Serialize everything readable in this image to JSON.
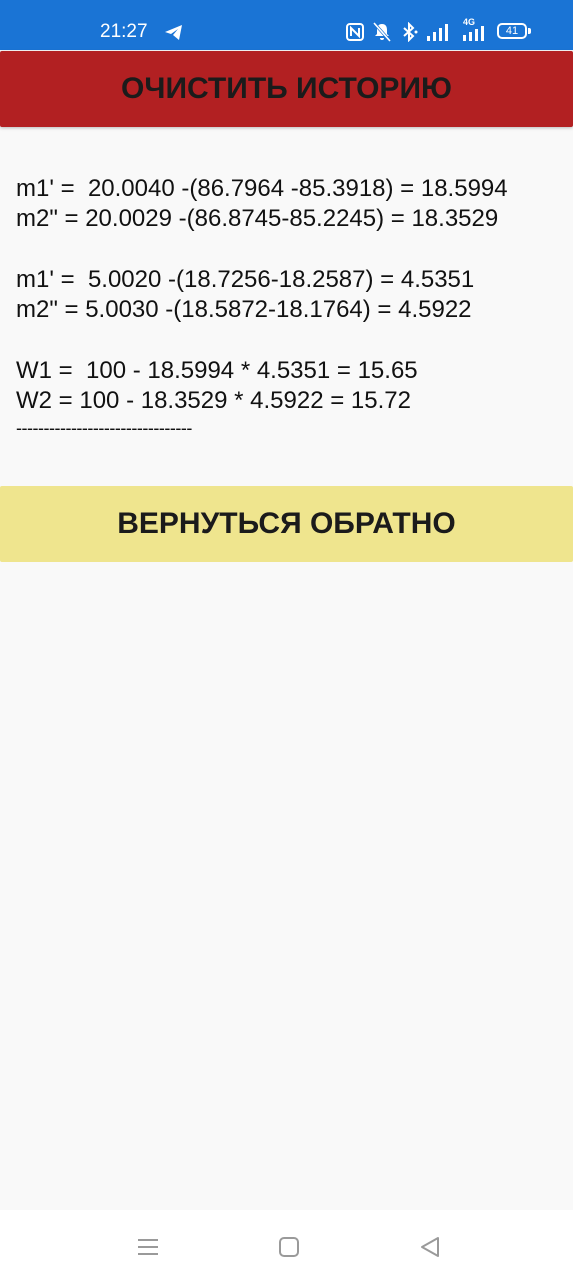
{
  "status_bar": {
    "time": "21:27",
    "network_label": "4G",
    "battery_level": "41",
    "icons": [
      "telegram-icon",
      "nfc-icon",
      "mute-icon",
      "bluetooth-icon",
      "signal-icon",
      "signal-4g-icon",
      "battery-icon"
    ]
  },
  "buttons": {
    "clear_history": "ОЧИСТИТЬ ИСТОРИЮ",
    "go_back": "ВЕРНУТЬСЯ ОБРАТНО"
  },
  "history": {
    "m1_first": "m1' =  20.0040 -(86.7964 -85.3918) = 18.5994",
    "m2_first": "m2\" = 20.0029 -(86.8745-85.2245) = 18.3529",
    "m1_second": "m1' =  5.0020 -(18.7256-18.2587) = 4.5351",
    "m2_second": "m2\" = 5.0030 -(18.5872-18.1764) = 4.5922",
    "w1": "W1 =  100 - 18.5994 * 4.5351 = 15.65",
    "w2": "W2 = 100 - 18.3529 * 4.5922 = 15.72",
    "divider": "--------------------------------"
  },
  "nav_bar": {
    "icons": [
      "menu-icon",
      "home-icon",
      "back-icon"
    ]
  },
  "colors": {
    "status_bar": "#1a74d5",
    "clear_button": "#b22022",
    "back_button": "#efe58e",
    "background": "#f9f9f9"
  }
}
